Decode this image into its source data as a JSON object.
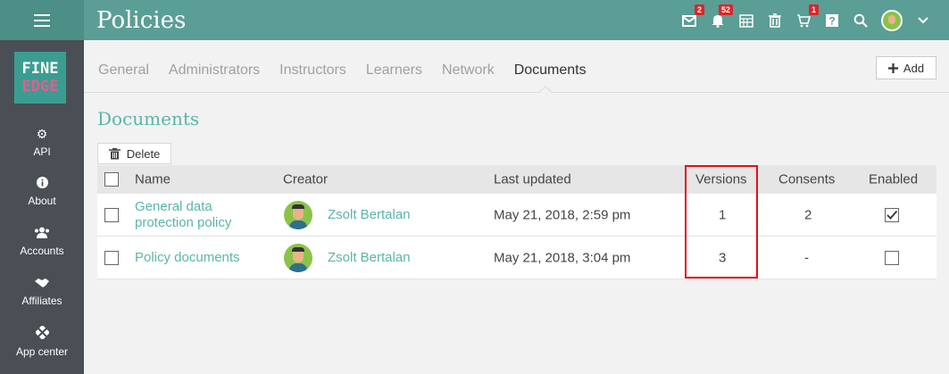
{
  "header": {
    "title": "Policies",
    "icons": [
      {
        "name": "messages-icon",
        "badge": "2"
      },
      {
        "name": "notifications-icon",
        "badge": "52"
      },
      {
        "name": "calendar-icon",
        "badge": ""
      },
      {
        "name": "trash-icon",
        "badge": ""
      },
      {
        "name": "cart-icon",
        "badge": "1"
      },
      {
        "name": "help-icon",
        "badge": ""
      },
      {
        "name": "search-icon",
        "badge": ""
      }
    ]
  },
  "sidebar": {
    "logo": {
      "line1": "FINE",
      "line2": "EDGE"
    },
    "items": [
      {
        "label": "API",
        "icon": "gear-icon"
      },
      {
        "label": "About",
        "icon": "info-icon"
      },
      {
        "label": "Accounts",
        "icon": "users-icon"
      },
      {
        "label": "Affiliates",
        "icon": "handshake-icon"
      },
      {
        "label": "App center",
        "icon": "apps-icon"
      }
    ]
  },
  "tabs": [
    "General",
    "Administrators",
    "Instructors",
    "Learners",
    "Network",
    "Documents"
  ],
  "active_tab": "Documents",
  "toolbar": {
    "add_label": "Add",
    "delete_label": "Delete"
  },
  "section": {
    "title": "Documents"
  },
  "table": {
    "columns": {
      "name": "Name",
      "creator": "Creator",
      "last_updated": "Last updated",
      "versions": "Versions",
      "consents": "Consents",
      "enabled": "Enabled"
    },
    "rows": [
      {
        "name_line1": "General data",
        "name_line2": "protection policy",
        "creator": "Zsolt Bertalan",
        "last_updated": "May 21, 2018, 2:59 pm",
        "versions": "1",
        "consents": "2",
        "enabled": true
      },
      {
        "name_line1": "Policy documents",
        "name_line2": "",
        "creator": "Zsolt Bertalan",
        "last_updated": "May 21, 2018, 3:04 pm",
        "versions": "3",
        "consents": "-",
        "enabled": false
      }
    ]
  },
  "colors": {
    "accent": "#5ab5a9",
    "topbar": "#5a9e96",
    "sidebar": "#4a4f55",
    "highlight": "#e0101c"
  }
}
